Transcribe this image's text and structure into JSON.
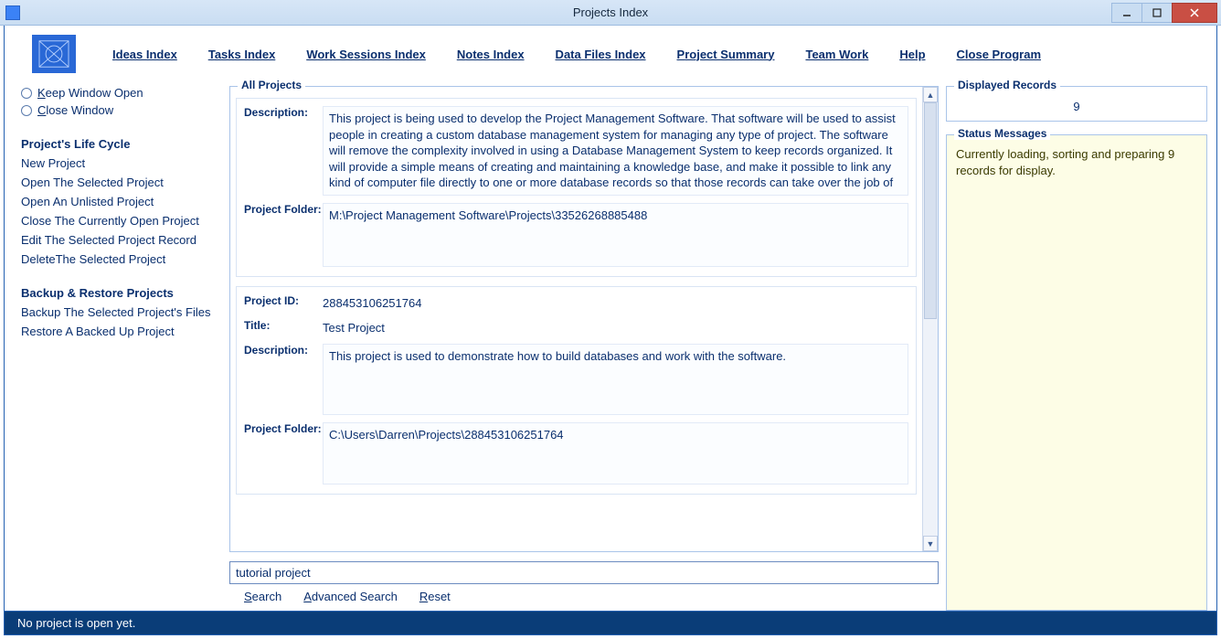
{
  "window": {
    "title": "Projects Index"
  },
  "menu": {
    "ideas": "Ideas Index",
    "tasks": "Tasks Index",
    "work_sessions": "Work Sessions Index",
    "notes": "Notes Index",
    "data_files": "Data Files Index",
    "project_summary": "Project Summary",
    "team_work": "Team Work",
    "help": "Help",
    "close_program": "Close Program"
  },
  "sidebar": {
    "keep_open": "Keep Window Open",
    "close_window": "Close Window",
    "lifecycle_heading": "Project's Life Cycle",
    "lifecycle": {
      "new": "New Project",
      "open_selected": "Open The Selected Project",
      "open_unlisted": "Open An Unlisted Project",
      "close_current": "Close The Currently Open Project",
      "edit_selected": "Edit The Selected Project Record",
      "delete_selected": "DeleteThe Selected Project"
    },
    "backup_heading": "Backup & Restore Projects",
    "backup": {
      "backup_selected": "Backup The Selected Project's Files",
      "restore": "Restore A Backed Up Project"
    }
  },
  "all_projects": {
    "legend": "All Projects",
    "labels": {
      "description": "Description:",
      "project_folder": "Project Folder:",
      "project_id": "Project ID:",
      "title": "Title:"
    },
    "record1": {
      "description": "This project is being used to develop the Project Management Software. That software will be used to assist people in creating a custom database management system for managing any type of project. The software will remove the complexity involved in using a Database Management System to keep records organized. It will provide a simple means of creating and maintaining a knowledge base, and make it possible to link any kind of computer file directly to one or more database records so that those records can take over the job of",
      "project_folder": "M:\\Project Management Software\\Projects\\33526268885488"
    },
    "record2": {
      "project_id": "288453106251764",
      "title": "Test Project",
      "description": "This project is used to demonstrate how to build databases and work with the software.",
      "project_folder": "C:\\Users\\Darren\\Projects\\288453106251764"
    }
  },
  "search": {
    "value": "tutorial project",
    "search_label": "Search",
    "advanced_label": "Advanced Search",
    "reset_label": "Reset"
  },
  "right": {
    "displayed_legend": "Displayed Records",
    "count": "9",
    "status_legend": "Status Messages",
    "status_text": "Currently loading, sorting and preparing 9 records for display."
  },
  "statusbar": "No project is open yet."
}
